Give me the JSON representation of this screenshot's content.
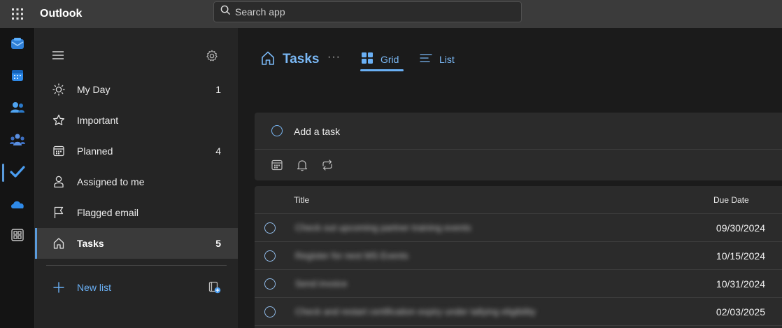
{
  "app": {
    "title": "Outlook"
  },
  "search": {
    "placeholder": "Search app"
  },
  "rail": {
    "items": [
      {
        "icon": "mail-icon"
      },
      {
        "icon": "calendar-icon"
      },
      {
        "icon": "people-icon"
      },
      {
        "icon": "teams-icon"
      },
      {
        "icon": "todo-check-icon",
        "active": true
      },
      {
        "icon": "onedrive-cloud-icon"
      },
      {
        "icon": "apps-grid-icon"
      }
    ]
  },
  "nav": {
    "items": [
      {
        "label": "My Day",
        "count": "1",
        "icon": "sun-icon"
      },
      {
        "label": "Important",
        "count": "",
        "icon": "star-icon"
      },
      {
        "label": "Planned",
        "count": "4",
        "icon": "calendar-grid-icon"
      },
      {
        "label": "Assigned to me",
        "count": "",
        "icon": "person-icon"
      },
      {
        "label": "Flagged email",
        "count": "",
        "icon": "flag-icon"
      },
      {
        "label": "Tasks",
        "count": "5",
        "icon": "home-icon",
        "selected": true
      }
    ],
    "new_list_label": "New list"
  },
  "header": {
    "title": "Tasks",
    "more": "···",
    "view_grid_label": "Grid",
    "view_list_label": "List"
  },
  "add_task": {
    "label": "Add a task"
  },
  "table": {
    "columns": {
      "title": "Title",
      "due": "Due Date"
    },
    "rows": [
      {
        "title": "Check out upcoming partner training events",
        "due": "09/30/2024"
      },
      {
        "title": "Register for next MS Events",
        "due": "10/15/2024"
      },
      {
        "title": "Send invoice",
        "due": "10/31/2024"
      },
      {
        "title": "Check and restart certification expiry under tallying eligibility",
        "due": "02/03/2025"
      }
    ]
  },
  "colors": {
    "accent": "#6ab0f5",
    "topbar": "#3b3b3b",
    "nav": "#252525",
    "card": "#2b2b2b"
  }
}
